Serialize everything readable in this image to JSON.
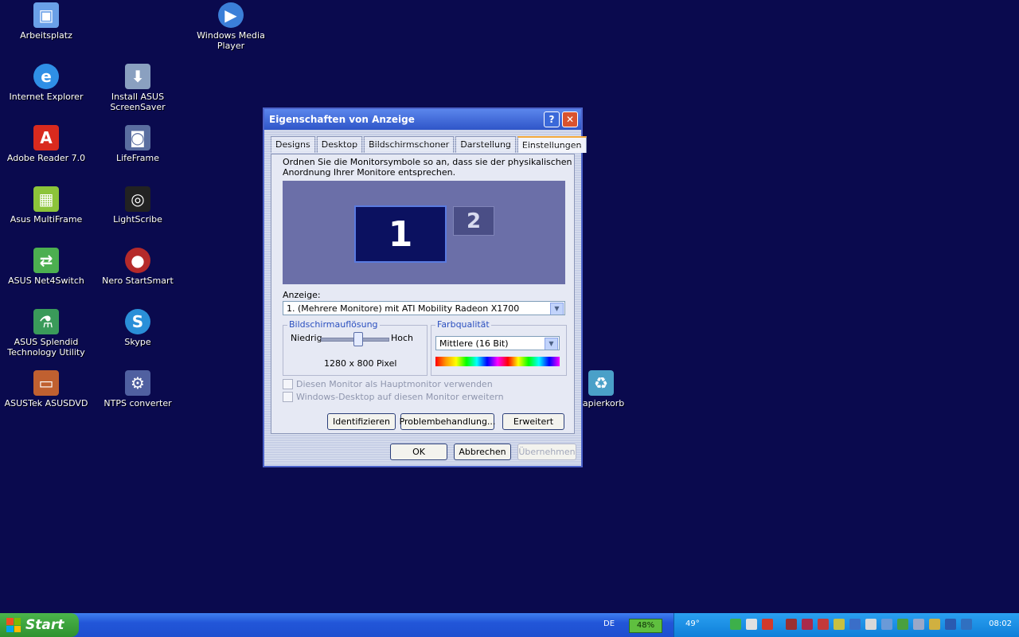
{
  "desktop": {
    "icons": [
      {
        "label": "Arbeitsplatz",
        "icon": "computer-icon",
        "color": "#6aa0e8"
      },
      {
        "label": "Windows Media Player",
        "icon": "media-player-icon",
        "color": "#3b7fd8"
      },
      {
        "label": "Internet Explorer",
        "icon": "internet-explorer-icon",
        "color": "#2f8fe6"
      },
      {
        "label": "Install ASUS ScreenSaver",
        "icon": "install-icon",
        "color": "#8aa0c0"
      },
      {
        "label": "Adobe Reader 7.0",
        "icon": "adobe-reader-icon",
        "color": "#d92a1e"
      },
      {
        "label": "LifeFrame",
        "icon": "lifeframe-icon",
        "color": "#5a6ea0"
      },
      {
        "label": "Asus MultiFrame",
        "icon": "multiframe-icon",
        "color": "#8cc43a"
      },
      {
        "label": "LightScribe",
        "icon": "lightscribe-icon",
        "color": "#222222"
      },
      {
        "label": "ASUS Net4Switch",
        "icon": "net4switch-icon",
        "color": "#4caf50"
      },
      {
        "label": "Nero StartSmart",
        "icon": "nero-icon",
        "color": "#b52a2a"
      },
      {
        "label": "ASUS Splendid Technology Utility",
        "icon": "splendid-icon",
        "color": "#3a9a5a"
      },
      {
        "label": "Skype",
        "icon": "skype-icon",
        "color": "#2a8fd8"
      },
      {
        "label": "ASUSTek ASUSDVD",
        "icon": "asusdvd-icon",
        "color": "#c06030"
      },
      {
        "label": "NTPS converter",
        "icon": "ntps-converter-icon",
        "color": "#5060a0"
      },
      {
        "label": "Papierkorb",
        "icon": "recycle-bin-icon",
        "color": "#4aa0c8"
      }
    ]
  },
  "dialog": {
    "title": "Eigenschaften von Anzeige",
    "help": "?",
    "close": "✕",
    "tabs": [
      "Designs",
      "Desktop",
      "Bildschirmschoner",
      "Darstellung",
      "Einstellungen"
    ],
    "instruction": "Ordnen Sie die Monitorsymbole so an, dass sie der physikalischen Anordnung Ihrer Monitore entsprechen.",
    "monitor1": "1",
    "monitor2": "2",
    "display_label": "Anzeige:",
    "display_value": "1. (Mehrere Monitore) mit ATI Mobility Radeon X1700",
    "resolution_group": "Bildschirmauflösung",
    "low": "Niedrig",
    "high": "Hoch",
    "resolution_value": "1280 x 800 Pixel",
    "resolution_slider_level": 0.55,
    "color_group": "Farbqualität",
    "color_value": "Mittlere (16 Bit)",
    "check1": "Diesen Monitor als Hauptmonitor verwenden",
    "check2": "Windows-Desktop auf diesen Monitor erweitern",
    "btn_identify": "Identifizieren",
    "btn_troubleshoot": "Problembehandlung...",
    "btn_advanced": "Erweitert",
    "btn_ok": "OK",
    "btn_cancel": "Abbrechen",
    "btn_apply": "Übernehmen"
  },
  "taskbar": {
    "start": "Start",
    "lang": "DE",
    "battery": "48%",
    "temp": "49°",
    "clock": "08:02"
  }
}
